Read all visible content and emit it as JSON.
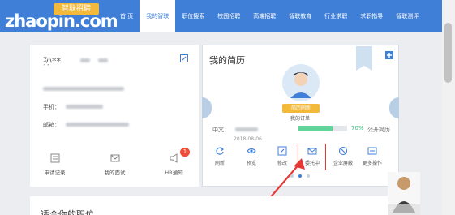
{
  "logo": {
    "text": "zhaopin.com",
    "badge": "智联招聘"
  },
  "nav": [
    "首 页",
    "我的智联",
    "职位搜索",
    "校园招聘",
    "高端招聘",
    "智联教育",
    "行业求职",
    "求职指导",
    "智联测评"
  ],
  "profile": {
    "name": "孙**",
    "phone_label": "手机：",
    "email_label": "邮箱："
  },
  "stats": [
    {
      "label": "申请记录"
    },
    {
      "label": "我的面试"
    },
    {
      "label": "HR通知",
      "badge": "1"
    }
  ],
  "resume": {
    "title": "我的简历",
    "vip": "简历刷新",
    "order": "我的订单",
    "lang_label": "中文：",
    "date": "2018-08-06",
    "progress_percent": 70,
    "progress_text": "70%",
    "public_label": "公开简历",
    "actions": [
      "刷新",
      "预览",
      "修改",
      "委托中",
      "企业屏蔽",
      "更多操作"
    ]
  },
  "lower": {
    "title": "适合你的职位"
  },
  "colors": {
    "brand": "#3f7fd8",
    "highlight": "#e53935",
    "progress": "#5fd49a"
  }
}
